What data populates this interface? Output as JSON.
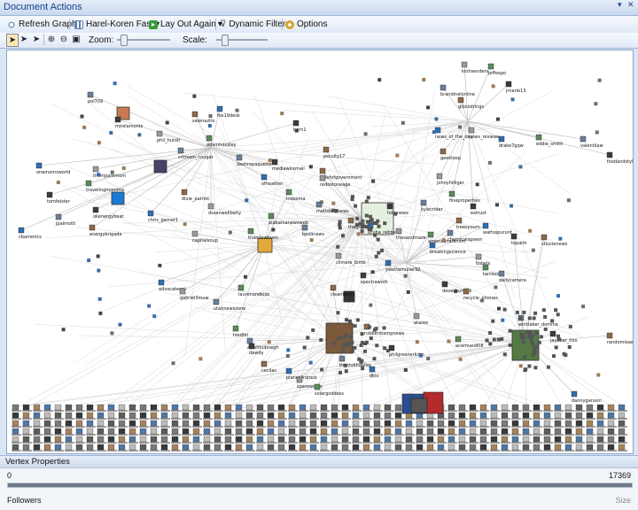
{
  "window": {
    "title": "Document Actions"
  },
  "toolbar": {
    "refresh_label": "Refresh Graph",
    "layout_select": "Harel-Koren Fast",
    "layout_again_label": "Lay Out Again",
    "dynamic_filters_label": "Dynamic Filters",
    "options_label": "Options",
    "zoom_label": "Zoom:",
    "scale_label": "Scale:",
    "zoom_level": 0.08,
    "scale_level": 0.12
  },
  "graph": {
    "vertices": [
      {
        "label": "pol709"
      },
      {
        "label": "mirelamonts"
      },
      {
        "label": "salenazito"
      },
      {
        "label": "fox19desk"
      },
      {
        "label": "phil_hurolt"
      },
      {
        "label": "adamhousley"
      },
      {
        "label": "crimson_cougar"
      },
      {
        "label": "born1"
      },
      {
        "label": "psculty17"
      },
      {
        "label": "onemomsworld"
      },
      {
        "label": "themparkmom"
      },
      {
        "label": "travelingmomma"
      },
      {
        "label": "dashrepaquette"
      },
      {
        "label": "mediawiremail"
      },
      {
        "label": "chiefofgovernment"
      },
      {
        "label": "ofheather"
      },
      {
        "label": "redostoneage"
      },
      {
        "label": "indexma"
      },
      {
        "label": "mattdailynews"
      },
      {
        "label": "tomfeister"
      },
      {
        "label": "dixie_patriot"
      },
      {
        "label": "chris_garner1"
      },
      {
        "label": "dssenwellbeity"
      },
      {
        "label": "alabamanewsweb"
      },
      {
        "label": "jpalmotti"
      },
      {
        "label": "okenergybeat"
      },
      {
        "label": "energybrigade"
      },
      {
        "label": "cbarrenics"
      },
      {
        "label": "capitalsoup"
      },
      {
        "label": "tharclowbuon"
      },
      {
        "label": "bpolinews"
      },
      {
        "label": "hdinnews"
      },
      {
        "label": "thegreen"
      },
      {
        "label": "scuba_rebbe"
      },
      {
        "label": "thesandmaze"
      },
      {
        "label": "americanafaninn"
      },
      {
        "label": "chemicalsgreen"
      },
      {
        "label": "topalm"
      },
      {
        "label": "stlucienews"
      },
      {
        "label": "breakingscience"
      },
      {
        "label": "tlsbels"
      },
      {
        "label": "tanlloon"
      },
      {
        "label": "dailycamera"
      },
      {
        "label": "davesburdick"
      },
      {
        "label": "recycle_phones"
      },
      {
        "label": "advocateonl"
      },
      {
        "label": "gabriel3muw"
      },
      {
        "label": "laurenandkids"
      },
      {
        "label": "utahnewszone"
      },
      {
        "label": "spectrawork"
      },
      {
        "label": "cleantechn"
      },
      {
        "label": "ywettemuller92"
      },
      {
        "label": "climate_bimb"
      },
      {
        "label": "hiedtki"
      },
      {
        "label": "anishhubnegh"
      },
      {
        "label": "dawdy"
      },
      {
        "label": "cecilas"
      },
      {
        "label": "planet3rdrock"
      },
      {
        "label": "sparewords"
      },
      {
        "label": "solargoddess"
      },
      {
        "label": "theclubhablog"
      },
      {
        "label": "philgreenerkdm"
      },
      {
        "label": "rubberstampnews"
      },
      {
        "label": "dkiv"
      },
      {
        "label": "ataree"
      },
      {
        "label": "acerman808"
      },
      {
        "label": "whittaker_domino"
      },
      {
        "label": "jaybear_mio"
      },
      {
        "label": "randomleasspoken"
      },
      {
        "label": "dannyganson"
      },
      {
        "label": "kiohsenders"
      },
      {
        "label": "jeffexpo"
      },
      {
        "label": "brandinelonline"
      },
      {
        "label": "jrnarie13"
      },
      {
        "label": "gibcodrings"
      },
      {
        "label": "news_of_the_day"
      },
      {
        "label": "news_reviews"
      },
      {
        "label": "eddie_smith"
      },
      {
        "label": "valentilaw"
      },
      {
        "label": "foodandstyle"
      },
      {
        "label": "geekloop"
      },
      {
        "label": "drake7gqw"
      },
      {
        "label": "johnyhilliger"
      },
      {
        "label": "fineproperties"
      },
      {
        "label": "kylecrider"
      },
      {
        "label": "extrust"
      },
      {
        "label": "treesyourn"
      },
      {
        "label": "wattsspurunt"
      }
    ]
  },
  "vertex_properties": {
    "header": "Vertex Properties",
    "property": "Followers",
    "min": "0",
    "max": "17369",
    "size_label": "Size",
    "fill_fraction": 1.0
  }
}
